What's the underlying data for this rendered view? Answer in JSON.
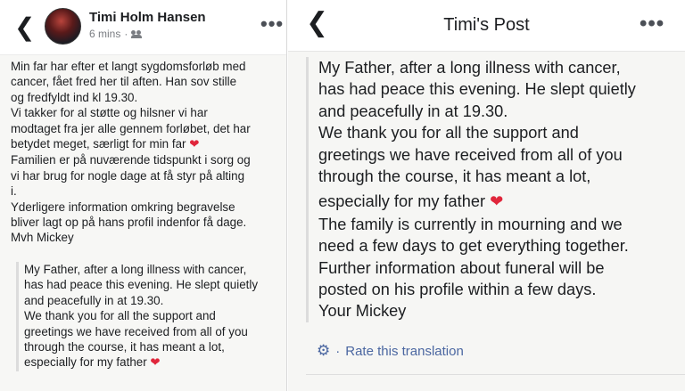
{
  "left": {
    "author": "Timi Holm Hansen",
    "timestamp": "6 mins",
    "separator": "·",
    "original_lines": [
      "Min far har efter et langt sygdomsforløb med",
      "cancer, fået fred her til aften. Han sov stille",
      "og fredfyldt ind kl 19.30.",
      "Vi takker for al støtte og hilsner vi har",
      "modtaget fra jer alle gennem forløbet, det har",
      "betydet meget, særligt for min far",
      "Familien er på nuværende tidspunkt i sorg og",
      "vi har brug for nogle dage at få styr på alting",
      "i.",
      "Yderligere information omkring begravelse",
      "bliver lagt op på hans profil indenfor få dage.",
      "Mvh Mickey"
    ],
    "translation_lines": [
      "My Father, after a long illness with cancer,",
      "has had peace this evening. He slept quietly",
      "and peacefully in at 19.30.",
      "We thank you for all the support and",
      "greetings we have received from all of you",
      "through the course, it has meant a lot,",
      "especially for my father"
    ]
  },
  "right": {
    "title": "Timi's Post",
    "translation_lines": [
      "My Father, after a long illness with cancer,",
      "has had peace this evening. He slept quietly",
      "and peacefully in at 19.30.",
      "We thank you for all the support and",
      "greetings we have received from all of you",
      "through the course, it has meant a lot,",
      "especially for my father",
      "The family is currently in mourning and we",
      "need a few days to get everything together.",
      "Further information about funeral will be",
      "posted on his profile within a few days.",
      "Your Mickey"
    ],
    "rate_sep": "·",
    "rate_label": "Rate this translation"
  },
  "icons": {
    "back": "chevron-left-icon",
    "more": "more-dots-icon",
    "audience": "friends-icon",
    "heart": "red-heart-icon",
    "settings": "gear-icon"
  },
  "colors": {
    "link": "#4b67a1",
    "heart": "#e0263b"
  }
}
